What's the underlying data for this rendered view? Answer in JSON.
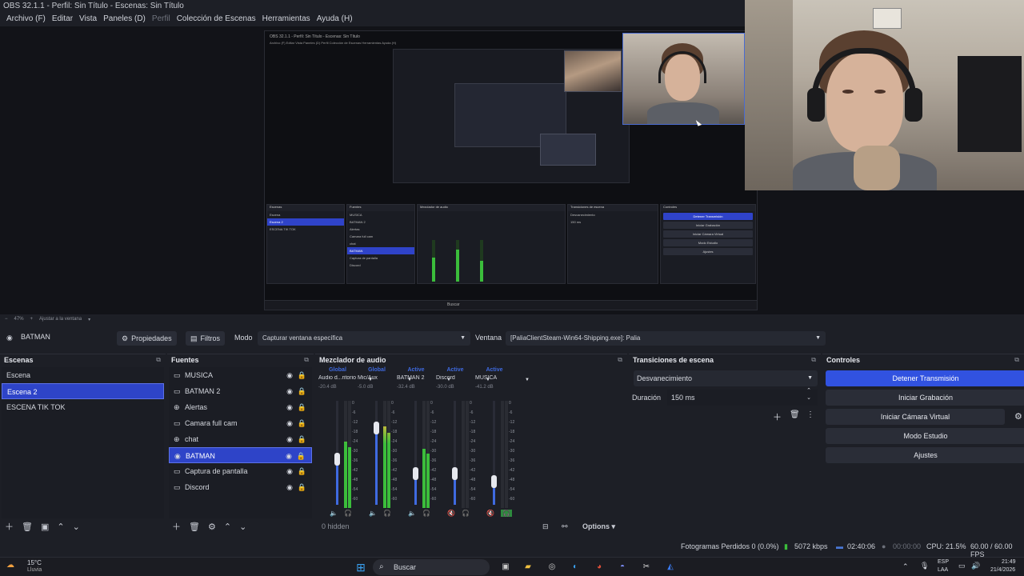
{
  "window": {
    "title": "OBS 32.1.1 - Perfil: Sin Título - Escenas: Sin Título"
  },
  "menu": [
    "Archivo (F)",
    "Editar",
    "Vista",
    "Paneles (D)",
    "Perfil",
    "Colección de Escenas",
    "Herramientas",
    "Ayuda (H)"
  ],
  "nested_preview": {
    "title": "OBS 32.1.1 - Perfil: Sin Título - Escenas: Sin Título",
    "menu": "Archivo (F)   Editar   Vista   Paneles (D)   Perfil   Colección de Escenas   Herramientas   Ayuda (H)",
    "scenes": [
      "Escena",
      "Escena 2",
      "ESCENA TIK TOK"
    ],
    "sources": [
      "MUSICA",
      "BATMAN 2",
      "Alertas",
      "Camara full cam",
      "chat",
      "BATMAN",
      "Captura de pantalla",
      "Discord"
    ],
    "controls": [
      "Detener Transmisión",
      "Iniciar Grabación",
      "Iniciar Cámara Virtual",
      "Modo Estudio",
      "Ajustes"
    ],
    "transition": "Desvanecimiento",
    "duration": "150 ms",
    "search": "Buscar"
  },
  "zoom": {
    "level": "47%",
    "fit": "Ajustar a la ventana"
  },
  "sourcebar": {
    "selected_source": "BATMAN",
    "properties_label": "Propiedades",
    "filters_label": "Filtros",
    "mode_label": "Modo",
    "mode_value": "Capturar ventana específica",
    "window_label": "Ventana",
    "window_value": "[PaliaClientSteam-Win64-Shipping.exe]: Palia"
  },
  "scenes": {
    "title": "Escenas",
    "items": [
      "Escena",
      "Escena 2",
      "ESCENA TIK TOK"
    ],
    "selected": "Escena 2"
  },
  "sources": {
    "title": "Fuentes",
    "items": [
      {
        "label": "MUSICA",
        "icon": "music-icon"
      },
      {
        "label": "BATMAN 2",
        "icon": "window-capture-icon"
      },
      {
        "label": "Alertas",
        "icon": "browser-icon"
      },
      {
        "label": "Camara full cam",
        "icon": "camera-icon"
      },
      {
        "label": "chat",
        "icon": "browser-icon"
      },
      {
        "label": "BATMAN",
        "icon": "game-capture-icon"
      },
      {
        "label": "Captura de pantalla",
        "icon": "display-capture-icon"
      },
      {
        "label": "Discord",
        "icon": "window-capture-icon"
      }
    ],
    "selected": "BATMAN"
  },
  "mixer": {
    "title": "Mezclador de audio",
    "channels": [
      {
        "tag": "Global",
        "name": "Audio d...ritorio",
        "db": "-20.4 dB",
        "level": 0.62,
        "fader": 0.44
      },
      {
        "tag": "Global",
        "name": "Mic/Aux",
        "db": "-5.0 dB",
        "level": 0.76,
        "fader": 0.74
      },
      {
        "tag": "Active",
        "name": "BATMAN 2",
        "db": "-32.4 dB",
        "level": 0.55,
        "fader": 0.3
      },
      {
        "tag": "Active",
        "name": "Discord",
        "db": "-30.0 dB",
        "level": 0.0,
        "fader": 0.3
      },
      {
        "tag": "Active",
        "name": "MUSICA",
        "db": "-41.2 dB",
        "level": 0.0,
        "fader": 0.22
      }
    ],
    "scale": [
      "0",
      "-6",
      "-12",
      "-18",
      "-24",
      "-30",
      "-36",
      "-42",
      "-48",
      "-54",
      "-60"
    ],
    "hidden": "0 hidden",
    "options": "Options"
  },
  "transitions": {
    "title": "Transiciones de escena",
    "selected": "Desvanecimiento",
    "duration_label": "Duración",
    "duration_value": "150 ms"
  },
  "controls": {
    "title": "Controles",
    "stop_stream": "Detener Transmisión",
    "start_recording": "Iniciar Grabación",
    "start_virtual_cam": "Iniciar Cámara Virtual",
    "studio_mode": "Modo Estudio",
    "settings": "Ajustes"
  },
  "status": {
    "dropped_frames": "Fotogramas Perdidos 0 (0.0%)",
    "bitrate": "5072 kbps",
    "stream_time": "02:40:06",
    "record_time": "00:00:00",
    "cpu": "CPU: 21.5%",
    "fps": "60.00 / 60.00 FPS"
  },
  "taskbar": {
    "weather_temp": "15°C",
    "weather_desc": "Lluvia",
    "search": "Buscar",
    "lang": "ESP",
    "lang2": "LAA",
    "time": "21:49",
    "date": "21/4/2026"
  },
  "colors": {
    "accent": "#2e44c8",
    "primary_button": "#3152e0",
    "meter_green": "#3bbd3b",
    "meter_red": "#b83030"
  }
}
